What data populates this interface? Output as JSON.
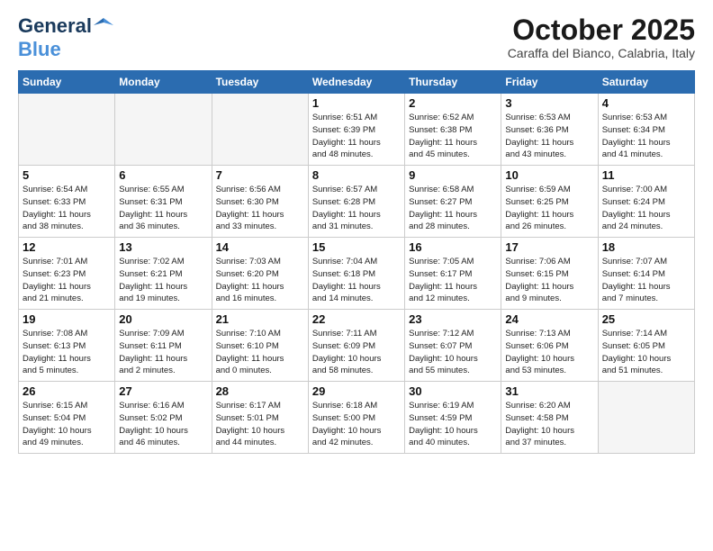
{
  "header": {
    "logo_general": "General",
    "logo_blue": "Blue",
    "month_title": "October 2025",
    "subtitle": "Caraffa del Bianco, Calabria, Italy"
  },
  "weekdays": [
    "Sunday",
    "Monday",
    "Tuesday",
    "Wednesday",
    "Thursday",
    "Friday",
    "Saturday"
  ],
  "weeks": [
    [
      {
        "day": "",
        "info": ""
      },
      {
        "day": "",
        "info": ""
      },
      {
        "day": "",
        "info": ""
      },
      {
        "day": "1",
        "info": "Sunrise: 6:51 AM\nSunset: 6:39 PM\nDaylight: 11 hours\nand 48 minutes."
      },
      {
        "day": "2",
        "info": "Sunrise: 6:52 AM\nSunset: 6:38 PM\nDaylight: 11 hours\nand 45 minutes."
      },
      {
        "day": "3",
        "info": "Sunrise: 6:53 AM\nSunset: 6:36 PM\nDaylight: 11 hours\nand 43 minutes."
      },
      {
        "day": "4",
        "info": "Sunrise: 6:53 AM\nSunset: 6:34 PM\nDaylight: 11 hours\nand 41 minutes."
      }
    ],
    [
      {
        "day": "5",
        "info": "Sunrise: 6:54 AM\nSunset: 6:33 PM\nDaylight: 11 hours\nand 38 minutes."
      },
      {
        "day": "6",
        "info": "Sunrise: 6:55 AM\nSunset: 6:31 PM\nDaylight: 11 hours\nand 36 minutes."
      },
      {
        "day": "7",
        "info": "Sunrise: 6:56 AM\nSunset: 6:30 PM\nDaylight: 11 hours\nand 33 minutes."
      },
      {
        "day": "8",
        "info": "Sunrise: 6:57 AM\nSunset: 6:28 PM\nDaylight: 11 hours\nand 31 minutes."
      },
      {
        "day": "9",
        "info": "Sunrise: 6:58 AM\nSunset: 6:27 PM\nDaylight: 11 hours\nand 28 minutes."
      },
      {
        "day": "10",
        "info": "Sunrise: 6:59 AM\nSunset: 6:25 PM\nDaylight: 11 hours\nand 26 minutes."
      },
      {
        "day": "11",
        "info": "Sunrise: 7:00 AM\nSunset: 6:24 PM\nDaylight: 11 hours\nand 24 minutes."
      }
    ],
    [
      {
        "day": "12",
        "info": "Sunrise: 7:01 AM\nSunset: 6:23 PM\nDaylight: 11 hours\nand 21 minutes."
      },
      {
        "day": "13",
        "info": "Sunrise: 7:02 AM\nSunset: 6:21 PM\nDaylight: 11 hours\nand 19 minutes."
      },
      {
        "day": "14",
        "info": "Sunrise: 7:03 AM\nSunset: 6:20 PM\nDaylight: 11 hours\nand 16 minutes."
      },
      {
        "day": "15",
        "info": "Sunrise: 7:04 AM\nSunset: 6:18 PM\nDaylight: 11 hours\nand 14 minutes."
      },
      {
        "day": "16",
        "info": "Sunrise: 7:05 AM\nSunset: 6:17 PM\nDaylight: 11 hours\nand 12 minutes."
      },
      {
        "day": "17",
        "info": "Sunrise: 7:06 AM\nSunset: 6:15 PM\nDaylight: 11 hours\nand 9 minutes."
      },
      {
        "day": "18",
        "info": "Sunrise: 7:07 AM\nSunset: 6:14 PM\nDaylight: 11 hours\nand 7 minutes."
      }
    ],
    [
      {
        "day": "19",
        "info": "Sunrise: 7:08 AM\nSunset: 6:13 PM\nDaylight: 11 hours\nand 5 minutes."
      },
      {
        "day": "20",
        "info": "Sunrise: 7:09 AM\nSunset: 6:11 PM\nDaylight: 11 hours\nand 2 minutes."
      },
      {
        "day": "21",
        "info": "Sunrise: 7:10 AM\nSunset: 6:10 PM\nDaylight: 11 hours\nand 0 minutes."
      },
      {
        "day": "22",
        "info": "Sunrise: 7:11 AM\nSunset: 6:09 PM\nDaylight: 10 hours\nand 58 minutes."
      },
      {
        "day": "23",
        "info": "Sunrise: 7:12 AM\nSunset: 6:07 PM\nDaylight: 10 hours\nand 55 minutes."
      },
      {
        "day": "24",
        "info": "Sunrise: 7:13 AM\nSunset: 6:06 PM\nDaylight: 10 hours\nand 53 minutes."
      },
      {
        "day": "25",
        "info": "Sunrise: 7:14 AM\nSunset: 6:05 PM\nDaylight: 10 hours\nand 51 minutes."
      }
    ],
    [
      {
        "day": "26",
        "info": "Sunrise: 6:15 AM\nSunset: 5:04 PM\nDaylight: 10 hours\nand 49 minutes."
      },
      {
        "day": "27",
        "info": "Sunrise: 6:16 AM\nSunset: 5:02 PM\nDaylight: 10 hours\nand 46 minutes."
      },
      {
        "day": "28",
        "info": "Sunrise: 6:17 AM\nSunset: 5:01 PM\nDaylight: 10 hours\nand 44 minutes."
      },
      {
        "day": "29",
        "info": "Sunrise: 6:18 AM\nSunset: 5:00 PM\nDaylight: 10 hours\nand 42 minutes."
      },
      {
        "day": "30",
        "info": "Sunrise: 6:19 AM\nSunset: 4:59 PM\nDaylight: 10 hours\nand 40 minutes."
      },
      {
        "day": "31",
        "info": "Sunrise: 6:20 AM\nSunset: 4:58 PM\nDaylight: 10 hours\nand 37 minutes."
      },
      {
        "day": "",
        "info": ""
      }
    ]
  ]
}
